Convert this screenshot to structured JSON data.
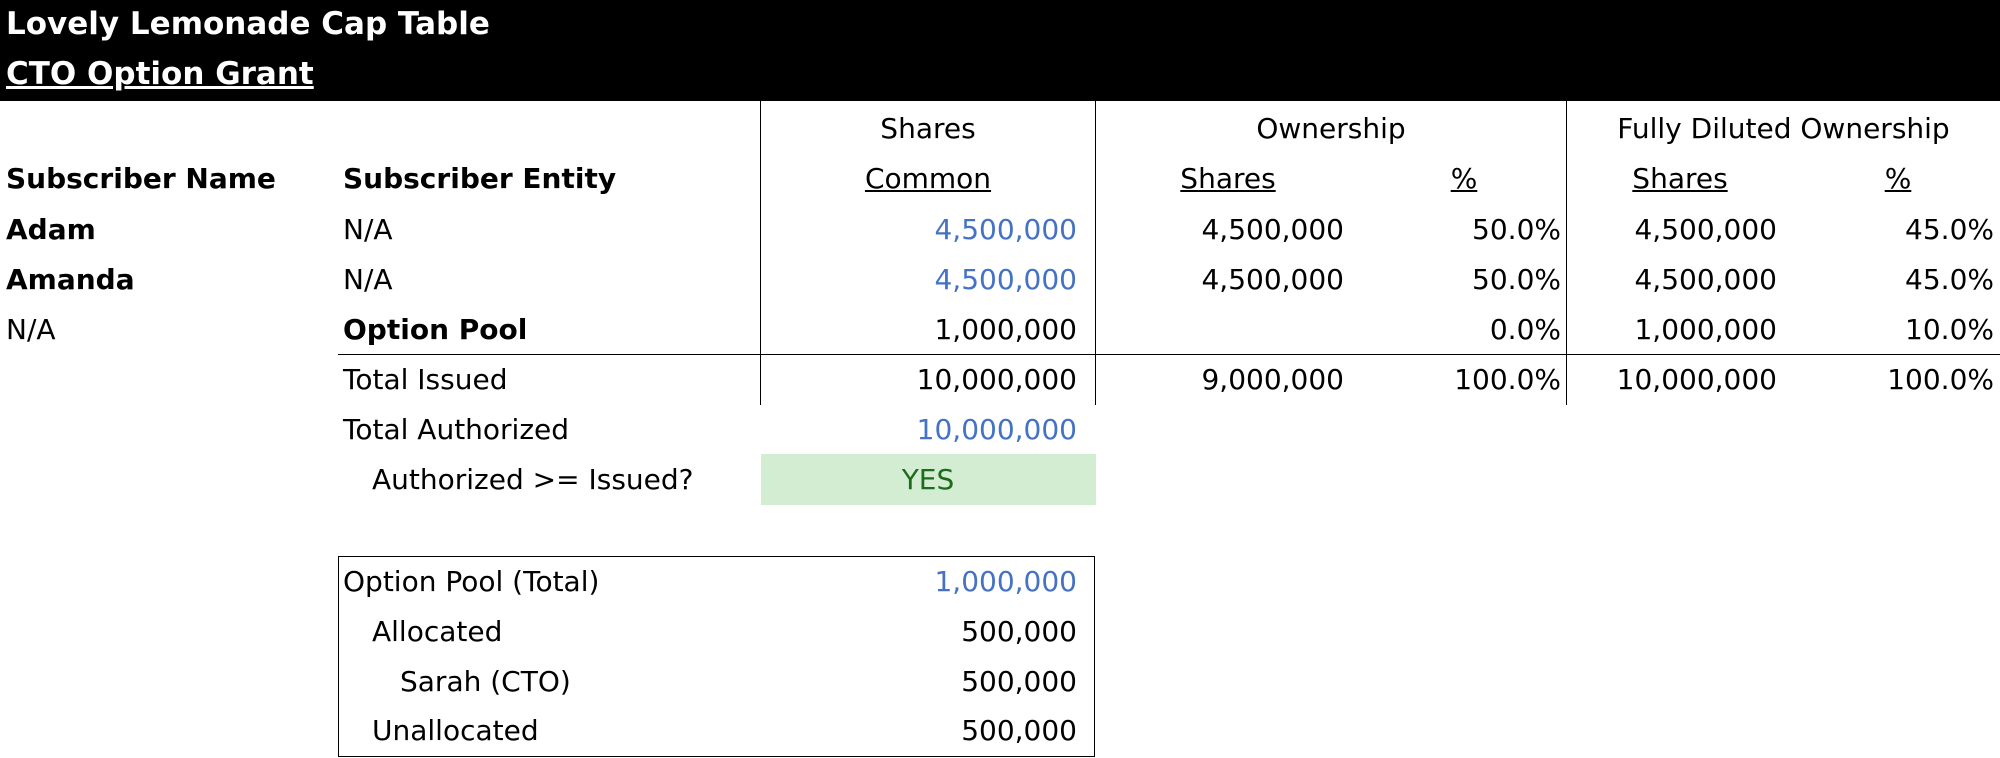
{
  "header": {
    "title": "Lovely Lemonade Cap Table",
    "subtitle": "CTO Option Grant"
  },
  "columns": {
    "shares_group": "Shares",
    "ownership_group": "Ownership",
    "fd_group": "Fully Diluted Ownership",
    "subscriber_name": "Subscriber Name",
    "subscriber_entity": "Subscriber Entity",
    "common": "Common",
    "own_shares": "Shares",
    "own_pct": "%",
    "fd_shares": "Shares",
    "fd_pct": "%"
  },
  "rows": [
    {
      "name": "Adam",
      "entity": "N/A",
      "common": "4,500,000",
      "own_shares": "4,500,000",
      "own_pct": "50.0%",
      "fd_shares": "4,500,000",
      "fd_pct": "45.0%"
    },
    {
      "name": "Amanda",
      "entity": "N/A",
      "common": "4,500,000",
      "own_shares": "4,500,000",
      "own_pct": "50.0%",
      "fd_shares": "4,500,000",
      "fd_pct": "45.0%"
    },
    {
      "name": "N/A",
      "entity": "Option Pool",
      "common": "1,000,000",
      "own_shares": "",
      "own_pct": "0.0%",
      "fd_shares": "1,000,000",
      "fd_pct": "10.0%"
    }
  ],
  "totals": {
    "issued_label": "Total Issued",
    "issued_common": "10,000,000",
    "issued_own_shares": "9,000,000",
    "issued_own_pct": "100.0%",
    "issued_fd_shares": "10,000,000",
    "issued_fd_pct": "100.0%",
    "authorized_label": "Total Authorized",
    "authorized_value": "10,000,000",
    "check_label": "Authorized >= Issued?",
    "check_value": "YES"
  },
  "option_pool": {
    "total_label": "Option Pool (Total)",
    "total_value": "1,000,000",
    "allocated_label": "Allocated",
    "allocated_value": "500,000",
    "grantee_label": "Sarah (CTO)",
    "grantee_value": "500,000",
    "unallocated_label": "Unallocated",
    "unallocated_value": "500,000"
  },
  "colors": {
    "input_blue": "#4472c4",
    "check_green_bg": "#d2edd2",
    "check_green_text": "#1e6b1e"
  }
}
